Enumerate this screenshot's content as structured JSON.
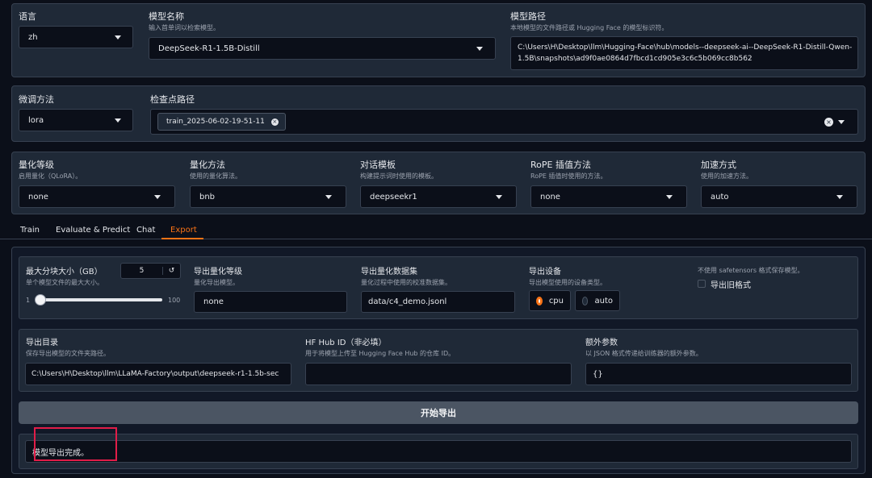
{
  "model_row": {
    "language": {
      "label": "语言",
      "value": "zh"
    },
    "model_name": {
      "label": "模型名称",
      "info": "输入首单词以检索模型。",
      "value": "DeepSeek-R1-1.5B-Distill"
    },
    "model_path": {
      "label": "模型路径",
      "info": "本地模型的文件路径或 Hugging Face 的模型标识符。",
      "value_line1": "C:\\Users\\H\\Desktop\\llm\\Hugging-Face\\hub\\models--deepseek-ai--DeepSeek-R1-Distill-Qwen-",
      "value_line2": "1.5B\\snapshots\\ad9f0ae0864d7fbcd1cd905e3c6c5b069cc8b562"
    }
  },
  "finetune_row": {
    "method": {
      "label": "微调方法",
      "value": "lora"
    },
    "checkpoint": {
      "label": "检查点路径",
      "chip": "train_2025-06-02-19-51-11"
    }
  },
  "advanced_row": {
    "quant_bit": {
      "label": "量化等级",
      "info": "启用量化（QLoRA）。",
      "value": "none"
    },
    "quant_method": {
      "label": "量化方法",
      "info": "使用的量化算法。",
      "value": "bnb"
    },
    "template": {
      "label": "对话模板",
      "info": "构建提示词时使用的模板。",
      "value": "deepseekr1"
    },
    "rope": {
      "label": "RoPE 插值方法",
      "info": "RoPE 插值时使用的方法。",
      "value": "none"
    },
    "booster": {
      "label": "加速方式",
      "info": "使用的加速方法。",
      "value": "auto"
    }
  },
  "tabs": [
    {
      "label": "Train"
    },
    {
      "label": "Evaluate & Predict"
    },
    {
      "label": "Chat"
    },
    {
      "label": "Export"
    }
  ],
  "export": {
    "shard": {
      "label": "最大分块大小（GB）",
      "info": "单个模型文件的最大大小。",
      "value": "5",
      "min": "1",
      "max": "100",
      "slider_fraction": 0.04
    },
    "export_quant_bit": {
      "label": "导出量化等级",
      "info": "量化导出模型。",
      "value": "none"
    },
    "export_quant_dataset": {
      "label": "导出量化数据集",
      "info": "量化过程中使用的校准数据集。",
      "value": "data/c4_demo.jsonl"
    },
    "export_device": {
      "label": "导出设备",
      "info": "导出模型使用的设备类型。",
      "options": [
        "cpu",
        "auto"
      ],
      "selected": "cpu"
    },
    "legacy": {
      "info": "不使用 safetensors 格式保存模型。",
      "label": "导出旧格式"
    },
    "export_dir": {
      "label": "导出目录",
      "info": "保存导出模型的文件夹路径。",
      "value": "C:\\Users\\H\\Desktop\\llm\\LLaMA-Factory\\output\\deepseek-r1-1.5b-sec"
    },
    "hub_id": {
      "label": "HF Hub ID（非必填）",
      "info": "用于将模型上传至 Hugging Face Hub 的仓库 ID。",
      "value": ""
    },
    "extra_args": {
      "label": "额外参数",
      "info": "以 JSON 格式传递给训练器的额外参数。",
      "value": "{}"
    },
    "button": "开始导出",
    "output": "模型导出完成。"
  },
  "colors": {
    "accent": "#f97316",
    "highlight": "#e11d48"
  }
}
